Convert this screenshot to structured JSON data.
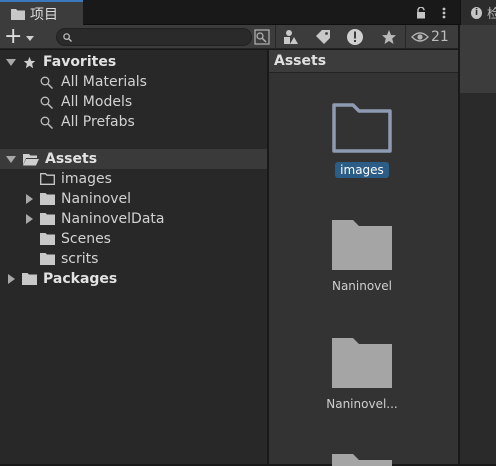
{
  "tab": {
    "title": "项目",
    "lock_icon": "lock-icon",
    "menu_icon": "kebab-menu-icon",
    "inspector_partial": "检"
  },
  "toolbar": {
    "add_label": "+",
    "search_placeholder": "",
    "hidden_count": "21"
  },
  "tree": {
    "favorites": {
      "label": "Favorites",
      "items": [
        "All Materials",
        "All Models",
        "All Prefabs"
      ]
    },
    "assets": {
      "label": "Assets",
      "items": [
        {
          "label": "images",
          "expandable": false,
          "folder": "empty"
        },
        {
          "label": "Naninovel",
          "expandable": true,
          "folder": "filled"
        },
        {
          "label": "NaninovelData",
          "expandable": true,
          "folder": "filled"
        },
        {
          "label": "Scenes",
          "expandable": false,
          "folder": "filled"
        },
        {
          "label": "scrits",
          "expandable": false,
          "folder": "filled"
        }
      ]
    },
    "packages": {
      "label": "Packages"
    }
  },
  "assets_panel": {
    "title": "Assets",
    "items": [
      {
        "label": "images",
        "selected": true,
        "folder": "empty"
      },
      {
        "label": "Naninovel",
        "selected": false,
        "folder": "filled"
      },
      {
        "label": "Naninovel...",
        "selected": false,
        "folder": "filled"
      }
    ]
  },
  "colors": {
    "selection": "#2c5d87",
    "active_tab_accent": "#3a79bb",
    "folder_fill": "#a5a5a5",
    "folder_selected_outline": "#8f9bb3"
  }
}
